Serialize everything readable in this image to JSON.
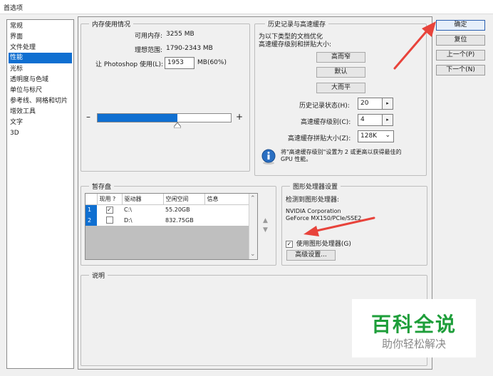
{
  "window": {
    "title": "首选项"
  },
  "sidebar": {
    "items": [
      {
        "label": "常规"
      },
      {
        "label": "界面"
      },
      {
        "label": "文件处理"
      },
      {
        "label": "性能"
      },
      {
        "label": "光标"
      },
      {
        "label": "透明度与色域"
      },
      {
        "label": "单位与标尺"
      },
      {
        "label": "参考线、网格和切片"
      },
      {
        "label": "增效工具"
      },
      {
        "label": "文字"
      },
      {
        "label": "3D"
      }
    ],
    "selected": "性能"
  },
  "memory": {
    "legend": "内存使用情况",
    "available_label": "可用内存:",
    "available_value": "3255 MB",
    "ideal_label": "理想范围:",
    "ideal_value": "1790-2343 MB",
    "let_label": "让 Photoshop 使用(L):",
    "let_value": "1953",
    "unit_label": "MB(60%)",
    "minus": "–",
    "plus": "+",
    "slider_fraction": 0.6
  },
  "history": {
    "legend": "历史记录与高速缓存",
    "desc_line1": "为以下类型的文档优化",
    "desc_line2": "高速缓存级别和拼贴大小:",
    "btn_tall_thin": "高而窄",
    "btn_default": "默认",
    "btn_big_flat": "大而平",
    "states_label": "历史记录状态(H):",
    "states_value": "20",
    "cache_levels_label": "高速缓存级别(C):",
    "cache_levels_value": "4",
    "tile_size_label": "高速缓存拼贴大小(Z):",
    "tile_size_value": "128K",
    "info_text_line1": "将\"高速缓存级别\"设置为 2 或更高以获得最佳的",
    "info_text_line2": "GPU 性能。",
    "spin_glyph": "▸",
    "dropdown_glyph": "⌄"
  },
  "scratch": {
    "legend": "暂存盘",
    "headers": [
      "现用 ?",
      "驱动器",
      "空闲空间",
      "信息"
    ],
    "rows": [
      {
        "index": "1",
        "active": "✓",
        "drive": "C:\\",
        "free": "55.20GB",
        "info": ""
      },
      {
        "index": "2",
        "active": "",
        "drive": "D:\\",
        "free": "832.75GB",
        "info": ""
      }
    ],
    "up_glyph": "▲",
    "down_glyph": "▼",
    "scroll_up_glyph": "⌃",
    "scroll_down_glyph": "⌄"
  },
  "gpu": {
    "legend": "图形处理器设置",
    "detected_label": "检测到图形处理器:",
    "vendor": "NVIDIA Corporation",
    "model": "GeForce MX150/PCIe/SSE2",
    "use_gpu_label": "使用图形处理器(G)",
    "use_gpu_checked": "✓",
    "advanced_button": "高级设置..."
  },
  "description": {
    "legend": "说明"
  },
  "buttons": {
    "ok": "确定",
    "reset": "复位",
    "prev": "上一个(P)",
    "next": "下一个(N)"
  },
  "watermark": {
    "title": "百科全说",
    "subtitle": "助你轻松解决"
  },
  "colors": {
    "accent": "#0f6fd1",
    "arrow": "#e8433b",
    "watermark_green": "#1e9e3a"
  }
}
